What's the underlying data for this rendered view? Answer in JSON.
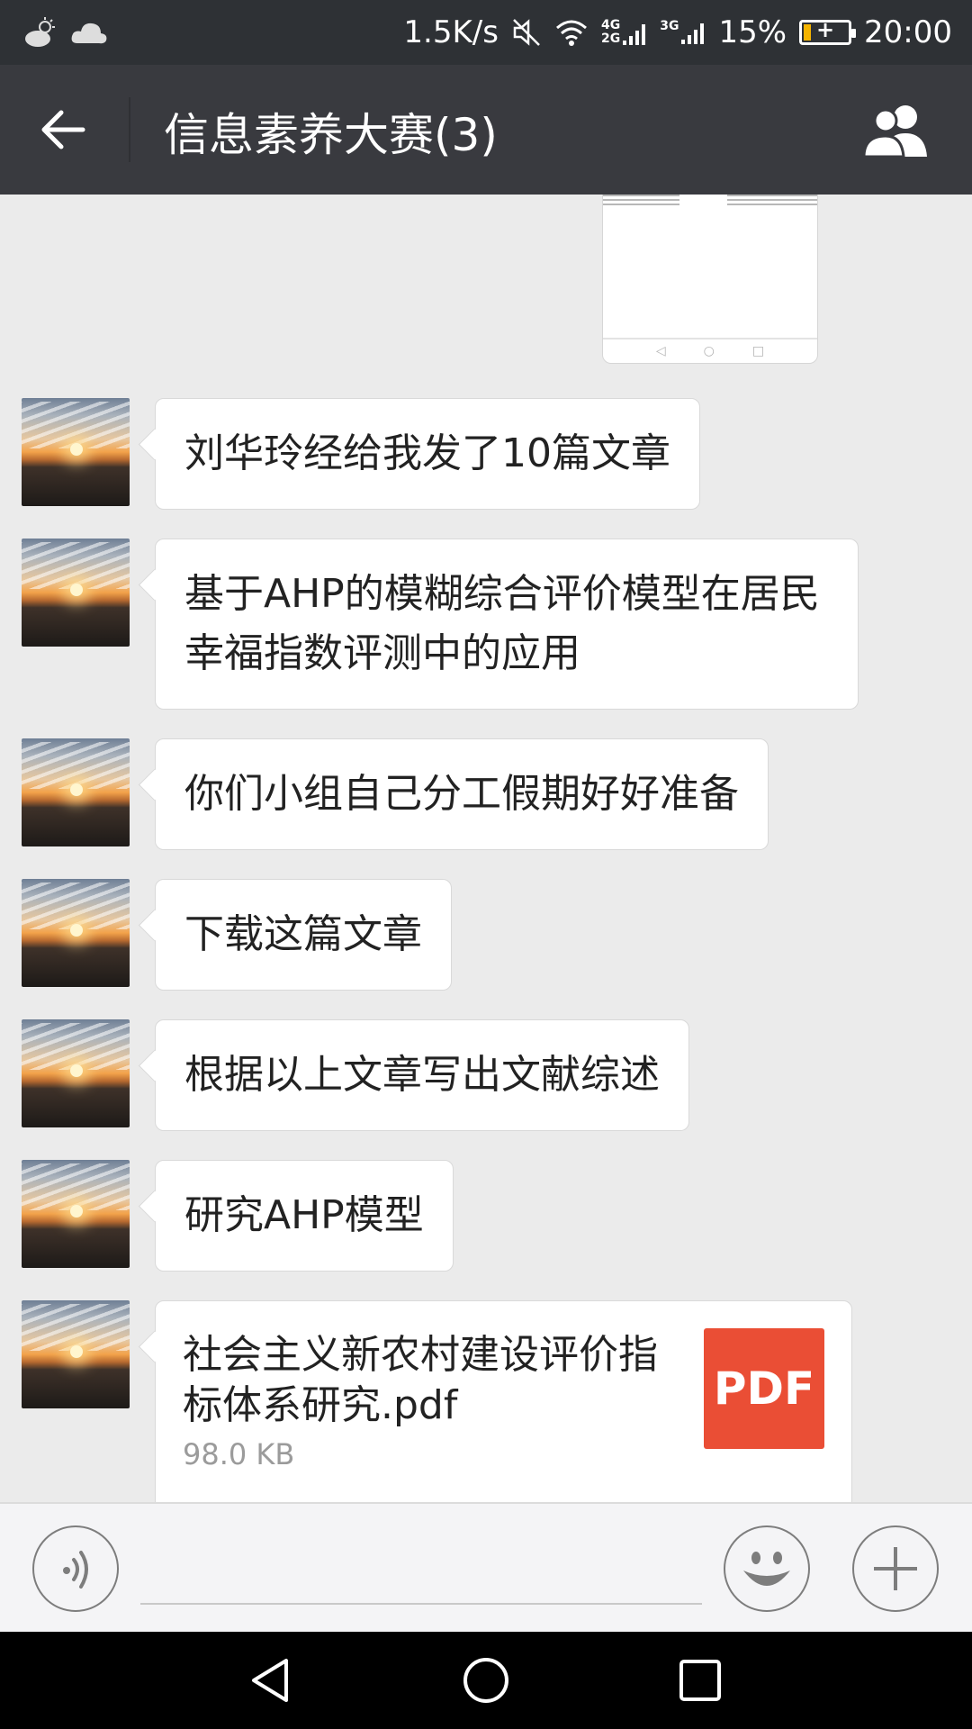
{
  "status_bar": {
    "network_speed": "1.5K/s",
    "network_type_1": "4G",
    "network_type_1_sub": "2G",
    "network_type_2": "3G",
    "battery_percent": "15%",
    "battery_level": 0.15,
    "time": "20:00",
    "icons": [
      "weather-sun-cloud-icon",
      "cloud-icon",
      "mute-icon",
      "wifi-icon",
      "signal-icon",
      "battery-charging-icon"
    ]
  },
  "header": {
    "title": "信息素养大赛(3)",
    "back_icon": "back-arrow-icon",
    "group_icon": "group-members-icon"
  },
  "messages": [
    {
      "type": "text",
      "text": "刘华玲经给我发了10篇文章"
    },
    {
      "type": "text",
      "text": "基于AHP的模糊综合评价模型在居民幸福指数评测中的应用"
    },
    {
      "type": "text",
      "text": "你们小组自己分工假期好好准备"
    },
    {
      "type": "text",
      "text": "下载这篇文章"
    },
    {
      "type": "text",
      "text": "根据以上文章写出文献综述"
    },
    {
      "type": "text",
      "text": "研究AHP模型"
    },
    {
      "type": "file",
      "file_name": "社会主义新农村建设评价指标体系研究.pdf",
      "file_size": "98.0 KB",
      "file_icon_label": "PDF"
    }
  ],
  "input_bar": {
    "text_value": "",
    "icons": [
      "voice-icon",
      "emoji-icon",
      "plus-icon"
    ]
  },
  "nav_bar": {
    "icons": [
      "nav-back-icon",
      "nav-home-icon",
      "nav-recent-icon"
    ]
  },
  "colors": {
    "status_bar_bg": "#2e3135",
    "title_bar_bg": "#393a3f",
    "chat_bg": "#ebebeb",
    "bubble_bg": "#ffffff",
    "pdf_red": "#ea4e35",
    "battery_yellow": "#f5b400"
  }
}
